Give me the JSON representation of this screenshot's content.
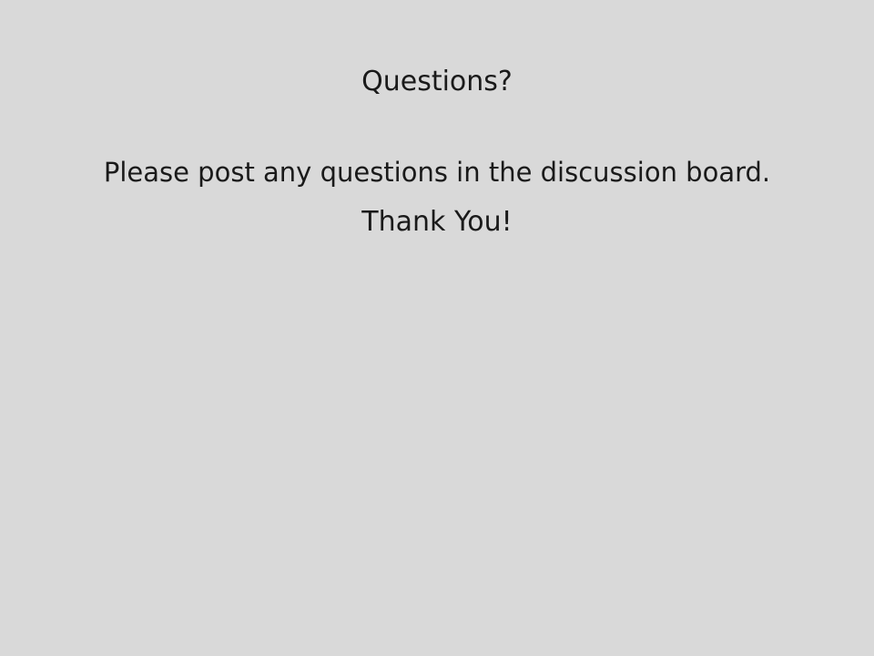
{
  "slide": {
    "title": "Questions?",
    "message": "Please post any questions in the discussion board.",
    "closing": "Thank You!"
  },
  "colors": {
    "background": "#d9d9d9",
    "text": "#1a1a1a"
  }
}
